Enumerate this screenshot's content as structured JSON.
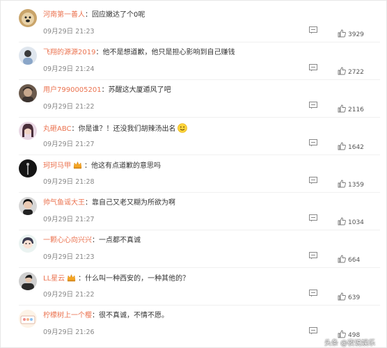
{
  "colors": {
    "username": "#eb7350",
    "text": "#333333",
    "meta": "#888888"
  },
  "comments": [
    {
      "user": "河南第一善人",
      "sep": "：",
      "text": "回应嫩达了个0呢",
      "time": "09月29日 21:23",
      "likes": "3929"
    },
    {
      "user": "飞翔的源源2019",
      "sep": "：",
      "text": "他不是想道歉，他只是担心影响到自己赚钱",
      "time": "09月29日 21:24",
      "likes": "2722"
    },
    {
      "user": "用户7990005201",
      "sep": "：",
      "text": "苏醒这大厦遁风了吧",
      "time": "09月29日 21:22",
      "likes": "2116"
    },
    {
      "user": "丸砸ABC",
      "sep": "：",
      "text": "你是谁？！还没我们胡辣汤出名",
      "time": "09月29日 21:27",
      "likes": "1642"
    },
    {
      "user": "珂珂马甲",
      "sep": "：",
      "text": "他这有点道歉的意思吗",
      "time": "09月29日 21:28",
      "likes": "1359"
    },
    {
      "user": "帅气鱼谣大王",
      "sep": "：",
      "text": "靠自己又老又糊为所欲为啊",
      "time": "09月29日 21:27",
      "likes": "1034"
    },
    {
      "user": "一颗心心向兴兴",
      "sep": "：",
      "text": "一点都不真诚",
      "time": "09月29日 21:23",
      "likes": "664"
    },
    {
      "user": "LL星云",
      "sep": "：",
      "text": "什么叫一种西安的，一种其他的？",
      "time": "09月29日 21:22",
      "likes": "639"
    },
    {
      "user": "柠檬树上一个樱",
      "sep": "：",
      "text": "很不真诚，不情不愿。",
      "time": "09月29日 21:26",
      "likes": "498"
    }
  ],
  "watermark": "头条 @夜说娱乐",
  "icons": {
    "reply": "comment-icon",
    "like": "thumbs-up-icon",
    "badge": "crown-badge-icon",
    "emoji": "smile-emoji-icon"
  }
}
